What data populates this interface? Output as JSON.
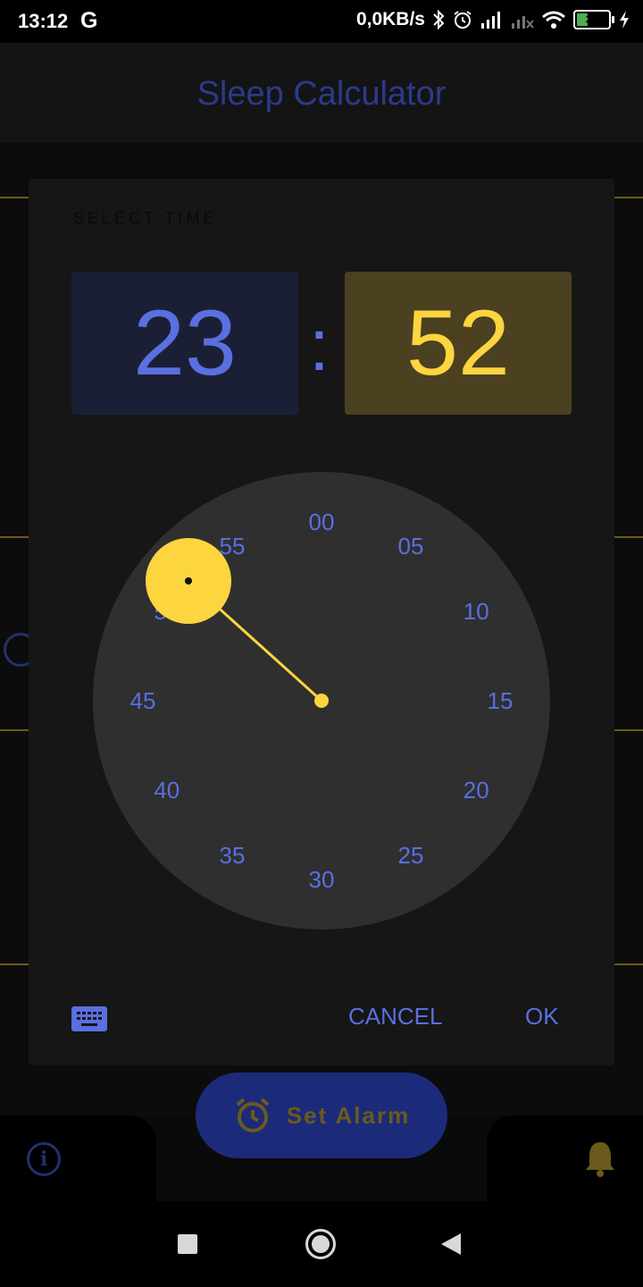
{
  "status_bar": {
    "time": "13:12",
    "g_icon": "G",
    "network_speed": "0,0KB/s",
    "battery_level": "34",
    "icons": [
      "bluetooth-icon",
      "alarm-icon",
      "signal-icon",
      "signal-x-icon",
      "wifi-icon",
      "battery-icon",
      "charging-icon"
    ]
  },
  "app": {
    "title": "Sleep Calculator",
    "set_alarm_label": "Set Alarm"
  },
  "dialog": {
    "title": "SELECT TIME",
    "hour": "23",
    "minute": "52",
    "colon": ":",
    "clock_numbers": [
      "00",
      "05",
      "10",
      "15",
      "20",
      "25",
      "30",
      "35",
      "40",
      "45",
      "50",
      "55"
    ],
    "selected_minute_value": 52,
    "cancel_label": "CANCEL",
    "ok_label": "OK"
  },
  "colors": {
    "accent_blue": "#5a6fe0",
    "accent_yellow": "#fcd53f",
    "dialog_bg": "#161616",
    "clock_face": "#2f2f2f"
  }
}
